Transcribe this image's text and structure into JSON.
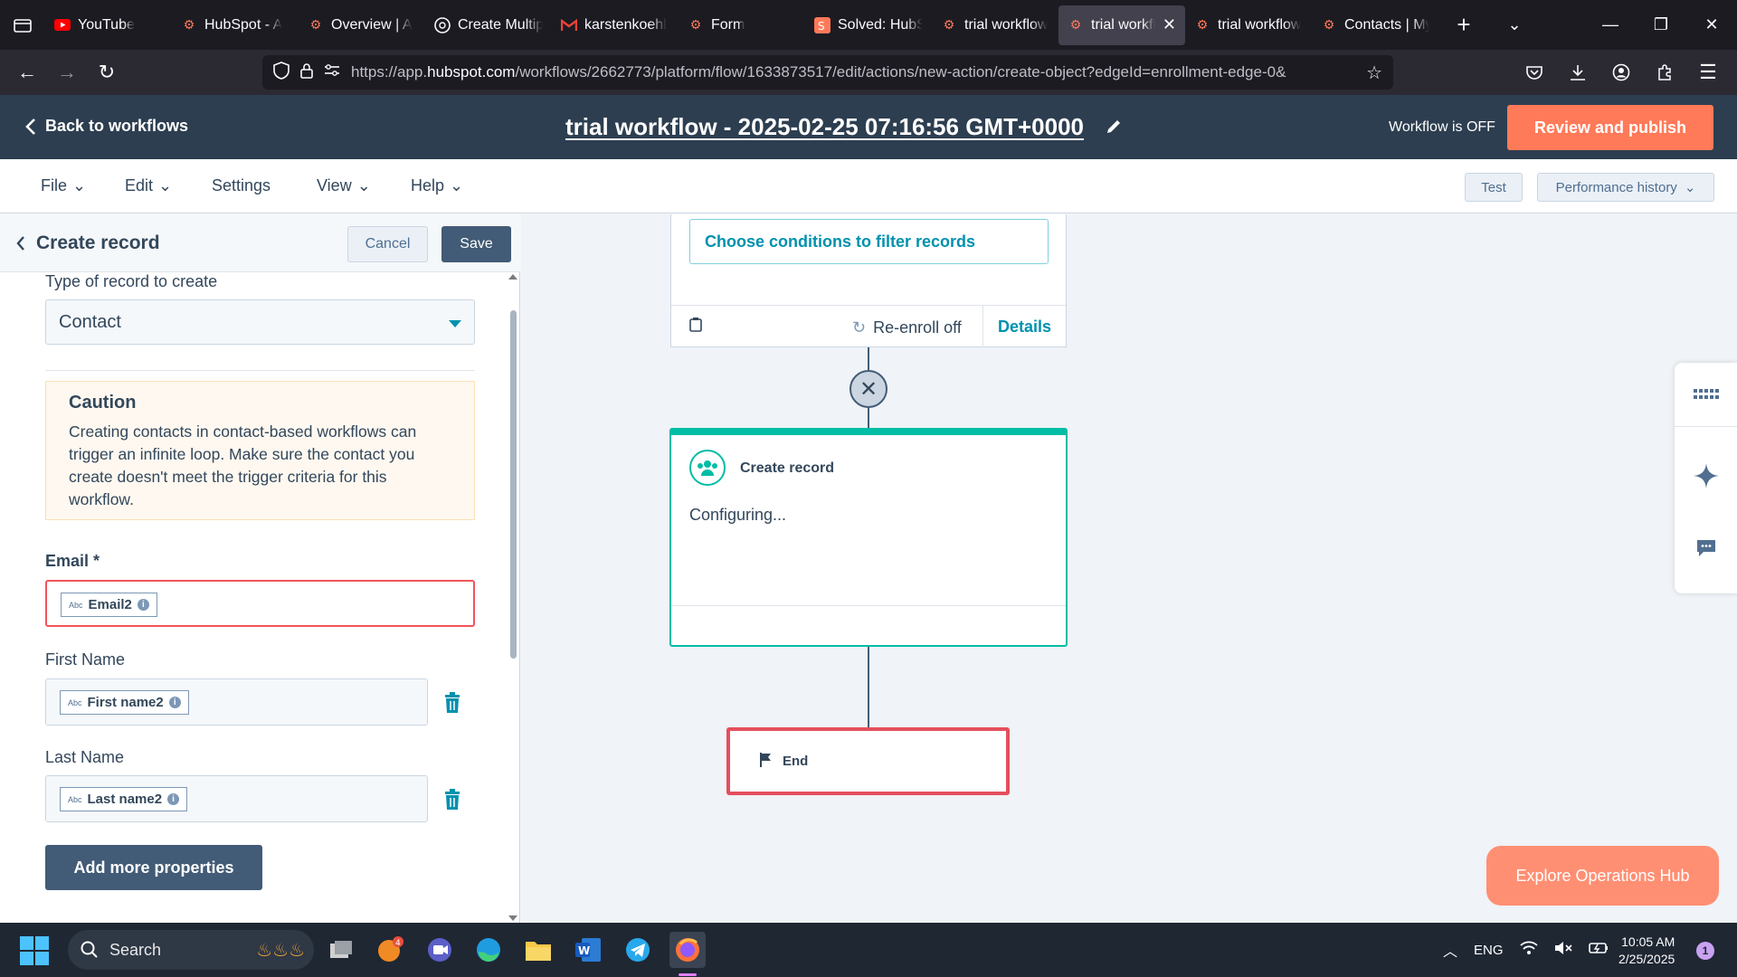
{
  "browser": {
    "tabs": [
      {
        "label": "YouTube",
        "icon": "youtube-icon",
        "active": false
      },
      {
        "label": "HubSpot - A",
        "icon": "hubspot-icon",
        "active": false
      },
      {
        "label": "Overview | A",
        "icon": "hubspot-icon",
        "active": false
      },
      {
        "label": "Create Multip",
        "icon": "openai-icon",
        "active": false
      },
      {
        "label": "karstenkoehl",
        "icon": "gmail-icon",
        "active": false
      },
      {
        "label": "Form",
        "icon": "hubspot-icon",
        "active": false
      },
      {
        "label": "Solved: HubS",
        "icon": "hubspot-community-icon",
        "active": false
      },
      {
        "label": "trial workflow",
        "icon": "hubspot-icon",
        "active": false
      },
      {
        "label": "trial workfl",
        "icon": "hubspot-icon",
        "active": true
      },
      {
        "label": "trial workflow",
        "icon": "hubspot-icon",
        "active": false
      },
      {
        "label": "Contacts | My",
        "icon": "hubspot-icon",
        "active": false
      }
    ],
    "url_prefix": "https://app.",
    "url_domain": "hubspot.com",
    "url_rest": "/workflows/2662773/platform/flow/1633873517/edit/actions/new-action/create-object?edgeId=enrollment-edge-0&"
  },
  "header": {
    "back_label": "Back to workflows",
    "title": "trial workflow - 2025-02-25 07:16:56 GMT+0000",
    "status": "Workflow is OFF",
    "publish_label": "Review and publish"
  },
  "menu": {
    "file": "File",
    "edit": "Edit",
    "settings": "Settings",
    "view": "View",
    "help": "Help",
    "test": "Test",
    "performance": "Performance history"
  },
  "panel": {
    "title": "Create record",
    "cancel": "Cancel",
    "save": "Save",
    "record_type_label": "Type of record to create",
    "record_type_value": "Contact",
    "caution_title": "Caution",
    "caution_text": "Creating contacts in contact-based workflows can trigger an infinite loop. Make sure the contact you create doesn't meet the trigger criteria for this workflow.",
    "fields": [
      {
        "label": "Email *",
        "token": "Email2",
        "abc": "Abc"
      },
      {
        "label": "First Name",
        "token": "First name2",
        "abc": "Abc"
      },
      {
        "label": "Last Name",
        "token": "Last name2",
        "abc": "Abc"
      }
    ],
    "add_more": "Add more properties"
  },
  "canvas": {
    "filter_label": "Choose conditions to filter records",
    "reenroll": "Re-enroll off",
    "details": "Details",
    "action_title": "Create record",
    "action_status": "Configuring...",
    "end_label": "End",
    "explore": "Explore Operations Hub"
  },
  "taskbar": {
    "search": "Search",
    "lang": "ENG",
    "time": "10:05 AM",
    "date": "2/25/2025",
    "notif_count": "1",
    "badge_count": "4"
  },
  "colors": {
    "hubspot_navy": "#2d3e50",
    "accent_orange": "#ff7a59",
    "teal": "#00bda5",
    "error_red": "#f2545b",
    "link_blue": "#0091ae"
  }
}
